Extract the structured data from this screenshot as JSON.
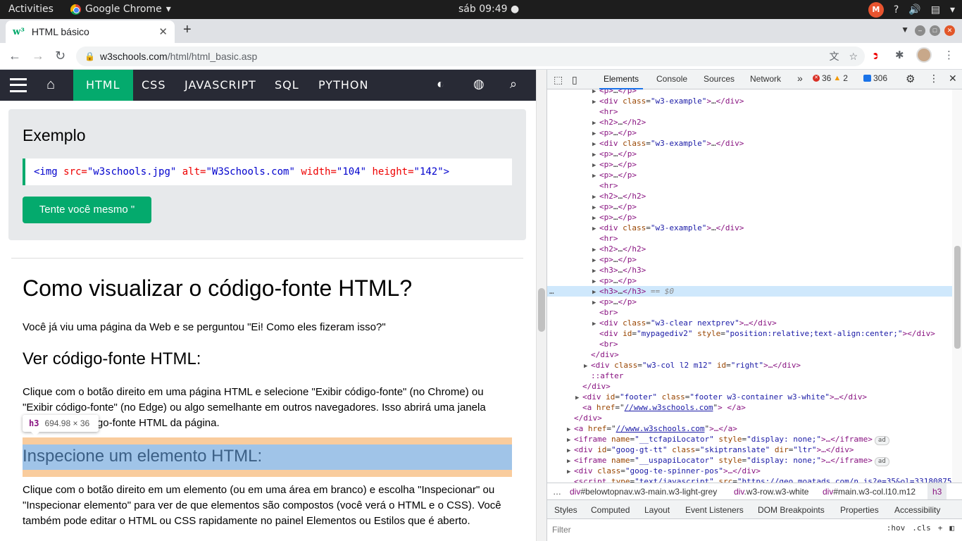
{
  "os": {
    "activities": "Activities",
    "app_name": "Google Chrome",
    "clock": "sáb 09:49"
  },
  "browser": {
    "tab_title": "HTML básico",
    "url_domain": "w3schools.com",
    "url_path": "/html/html_basic.asp"
  },
  "w3": {
    "nav": [
      "HTML",
      "CSS",
      "JAVASCRIPT",
      "SQL",
      "PYTHON"
    ],
    "example_title": "Exemplo",
    "code": {
      "tag_open": "<img",
      "src_attr": " src=",
      "src_val": "\"w3schools.jpg\"",
      "alt_attr": " alt=",
      "alt_val": "\"W3Schools.com\"",
      "w_attr": " width=",
      "w_val": "\"104\"",
      "h_attr": " height=",
      "h_val": "\"142\"",
      "tag_close": ">"
    },
    "try_button": "Tente você mesmo \"",
    "h1": "Como visualizar o código-fonte HTML?",
    "p1": "Você já viu uma página da Web e se perguntou \"Ei! Como eles fizeram isso?\"",
    "h2a": "Ver código-fonte HTML:",
    "p2": "Clique com o botão direito em uma página HTML e selecione \"Exibir código-fonte\" (no Chrome) ou \"Exibir código-fonte\" (no Edge) ou algo semelhante em outros navegadores. Isso abrirá uma janela contendo o código-fonte HTML da página.",
    "tooltip_tag": "h3",
    "tooltip_size": "694.98 × 36",
    "h2b": "Inspecione um elemento HTML:",
    "p3": "Clique com o botão direito em um elemento (ou em uma área em branco) e escolha \"Inspecionar\" ou \"Inspecionar elemento\" para ver de que elementos são compostos (você verá o HTML e o CSS). Você também pode editar o HTML ou CSS rapidamente no painel Elementos ou Estilos que é aberto."
  },
  "devtools": {
    "tabs": [
      "Elements",
      "Console",
      "Sources",
      "Network"
    ],
    "more": "»",
    "errors": "36",
    "warnings": "2",
    "messages": "306",
    "tree": [
      {
        "t": "c",
        "i": 0,
        "pre": "<p>",
        "mid": "…",
        "post": "</p>"
      },
      {
        "t": "d",
        "i": 0,
        "cls": "w3-example"
      },
      {
        "t": "v",
        "i": 1,
        "txt": "<hr>"
      },
      {
        "t": "c",
        "i": 0,
        "pre": "<h2>",
        "mid": "…",
        "post": "</h2>"
      },
      {
        "t": "c",
        "i": 0,
        "pre": "<p>",
        "mid": "…",
        "post": "</p>"
      },
      {
        "t": "d",
        "i": 0,
        "cls": "w3-example"
      },
      {
        "t": "c",
        "i": 0,
        "pre": "<p>",
        "mid": "…",
        "post": "</p>"
      },
      {
        "t": "c",
        "i": 0,
        "pre": "<p>",
        "mid": "…",
        "post": "</p>"
      },
      {
        "t": "c",
        "i": 0,
        "pre": "<p>",
        "mid": "…",
        "post": "</p>"
      },
      {
        "t": "v",
        "i": 1,
        "txt": "<hr>"
      },
      {
        "t": "c",
        "i": 0,
        "pre": "<h2>",
        "mid": "…",
        "post": "</h2>"
      },
      {
        "t": "c",
        "i": 0,
        "pre": "<p>",
        "mid": "…",
        "post": "</p>"
      },
      {
        "t": "c",
        "i": 0,
        "pre": "<p>",
        "mid": "…",
        "post": "</p>"
      },
      {
        "t": "d",
        "i": 0,
        "cls": "w3-example"
      },
      {
        "t": "v",
        "i": 1,
        "txt": "<hr>"
      },
      {
        "t": "c",
        "i": 0,
        "pre": "<h2>",
        "mid": "…",
        "post": "</h2>"
      },
      {
        "t": "c",
        "i": 0,
        "pre": "<p>",
        "mid": "…",
        "post": "</p>"
      },
      {
        "t": "c",
        "i": 0,
        "pre": "<h3>",
        "mid": "…",
        "post": "</h3>"
      },
      {
        "t": "c",
        "i": 0,
        "pre": "<p>",
        "mid": "…",
        "post": "</p>"
      },
      {
        "t": "s",
        "i": 0,
        "pre": "<h3>",
        "mid": "…",
        "post": "</h3>",
        "eq": " == $0"
      },
      {
        "t": "c",
        "i": 0,
        "pre": "<p>",
        "mid": "…",
        "post": "</p>"
      },
      {
        "t": "v",
        "i": 1,
        "txt": "<br>"
      }
    ],
    "rows2": {
      "clear": {
        "pre": "<div ",
        "a": "class",
        "v": "\"w3-clear nextprev\"",
        "post": ">…</div>"
      },
      "mypage": {
        "pre": "<div ",
        "a1": "id",
        "v1": "\"mypagediv2\"",
        "a2": " style",
        "v2": "\"position:relative;text-align:center;\"",
        "post": "></div>"
      },
      "br": "<br>",
      "enddiv": "</div>",
      "col": {
        "pre": "<div ",
        "a1": "class",
        "v1": "\"w3-col l2 m12\"",
        "a2": " id",
        "v2": "\"right\"",
        "post": ">…</div>"
      },
      "after": "::after",
      "enddiv2": "</div>",
      "footer": {
        "pre": "<div ",
        "a1": "id",
        "v1": "\"footer\"",
        "a2": " class",
        "v2": "\"footer w3-container w3-white\"",
        "post": ">…</div>"
      },
      "ahref": {
        "pre": "<a ",
        "a": "href",
        "v": "//www.w3schools.com",
        "post": "> </a>"
      },
      "enddiv3": "</div>",
      "ahref2": {
        "pre": "<a ",
        "a": "href",
        "v": "//www.w3schools.com",
        "post": ">…</a>"
      },
      "iframe1": {
        "pre": "<iframe ",
        "a1": "name",
        "v1": "\"__tcfapiLocator\"",
        "a2": " style",
        "v2": "\"display: none;\"",
        "post": ">…</iframe>",
        "ad": "ad"
      },
      "googtt": {
        "pre": "<div ",
        "a1": "id",
        "v1": "\"goog-gt-tt\"",
        "a2": " class",
        "v2": "\"skiptranslate\"",
        "a3": " dir",
        "v3": "\"ltr\"",
        "post": ">…</div>"
      },
      "iframe2": {
        "pre": "<iframe ",
        "a1": "name",
        "v1": "\"__uspapiLocator\"",
        "a2": " style",
        "v2": "\"display: none;\"",
        "post": ">…</iframe>",
        "ad": "ad"
      },
      "spinner": {
        "pre": "<div ",
        "a": "class",
        "v": "\"goog-te-spinner-pos\"",
        "post": ">…</div>"
      },
      "script": {
        "pre": "<script ",
        "a1": "type",
        "v1": "\"text/javascript\"",
        "a2": " src=",
        "v2": "\"https://geo.moatads.com/n.js?e=35&ol=33180875"
      }
    },
    "breadcrumbs": [
      {
        "tag": "div",
        "rest": "#belowtopnav.w3-main.w3-light-grey"
      },
      {
        "tag": "div",
        "rest": ".w3-row.w3-white"
      },
      {
        "tag": "div",
        "rest": "#main.w3-col.l10.m12"
      },
      {
        "tag": "h3",
        "rest": ""
      }
    ],
    "style_tabs": [
      "Styles",
      "Computed",
      "Layout",
      "Event Listeners",
      "DOM Breakpoints",
      "Properties",
      "Accessibility"
    ],
    "filter_placeholder": "Filter",
    "hov": ":hov",
    "cls": ".cls"
  }
}
